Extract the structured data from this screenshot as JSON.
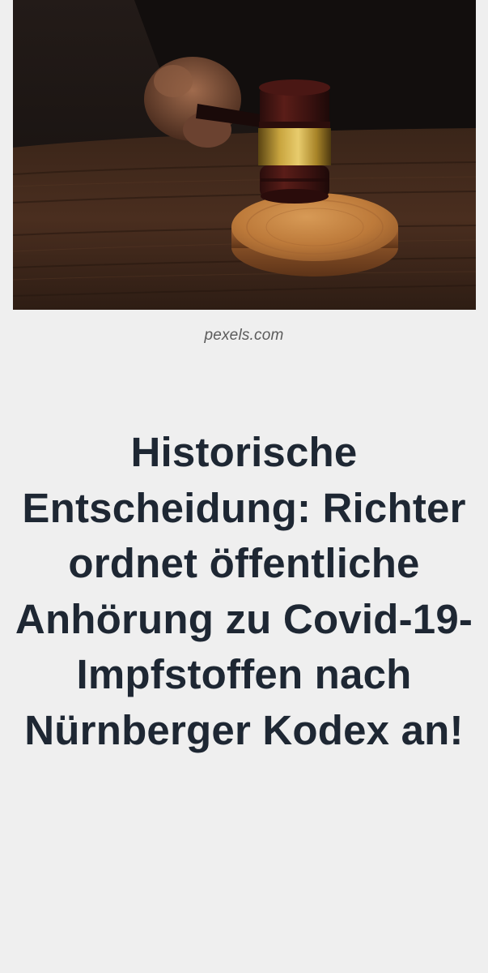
{
  "article": {
    "image": {
      "icon": "gavel-photo",
      "credit": "pexels.com"
    },
    "headline": "Historische Entscheidung: Richter ordnet öffentliche Anhörung zu Covid-19-Impfstoffen nach Nürnberger Kodex an!"
  },
  "colors": {
    "background": "#efefef",
    "headline": "#1e2733",
    "credit": "#5b5b5b"
  }
}
